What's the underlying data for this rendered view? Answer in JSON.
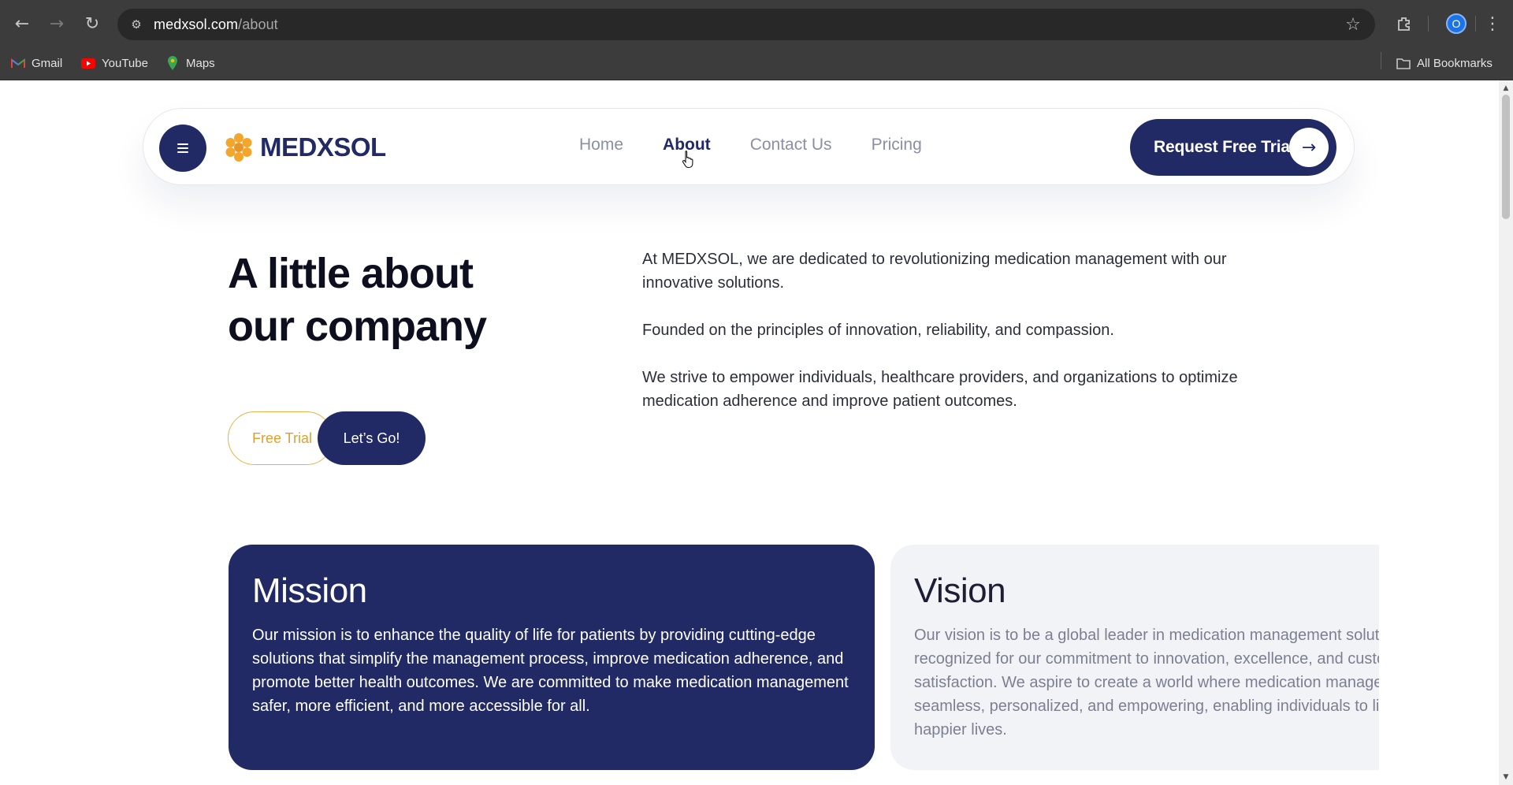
{
  "browser": {
    "url_host": "medxsol.com",
    "url_path": "/about",
    "profile_initial": "O",
    "bookmarks": [
      {
        "label": "Gmail",
        "icon": "gmail-icon"
      },
      {
        "label": "YouTube",
        "icon": "youtube-icon"
      },
      {
        "label": "Maps",
        "icon": "maps-icon"
      }
    ],
    "all_bookmarks_label": "All Bookmarks"
  },
  "header": {
    "brand": "MEDXSOL",
    "nav": [
      "Home",
      "About",
      "Contact Us",
      "Pricing"
    ],
    "active_nav": "About",
    "cta_label": "Request Free Trial"
  },
  "hero": {
    "title_line1": "A little about",
    "title_line2": "our company",
    "paragraphs": [
      "At MEDXSOL, we are dedicated to revolutionizing medication management with our innovative solutions.",
      "Founded on the principles of innovation, reliability, and compassion.",
      "We strive to empower individuals, healthcare providers, and organizations to optimize medication adherence and improve patient outcomes."
    ],
    "free_trial_label": "Free Trial",
    "lets_go_label": "Let’s Go!"
  },
  "cards": {
    "mission": {
      "title": "Mission",
      "text": "Our mission is to enhance the quality of life for patients by providing cutting-edge solutions that simplify the management process, improve medication adherence, and promote better health outcomes. We are committed to make medication management safer, more efficient, and more accessible for all."
    },
    "vision": {
      "title": "Vision",
      "text": "Our vision is to be a global leader in medication management solutions, recognized for our commitment to innovation, excellence, and customer satisfaction. We aspire to create a world where medication management is seamless, personalized, and empowering, enabling individuals to live healthier, happier lives."
    }
  },
  "colors": {
    "primary": "#212a65",
    "accent": "#f0a830",
    "muted_text": "#8a8fa3"
  }
}
